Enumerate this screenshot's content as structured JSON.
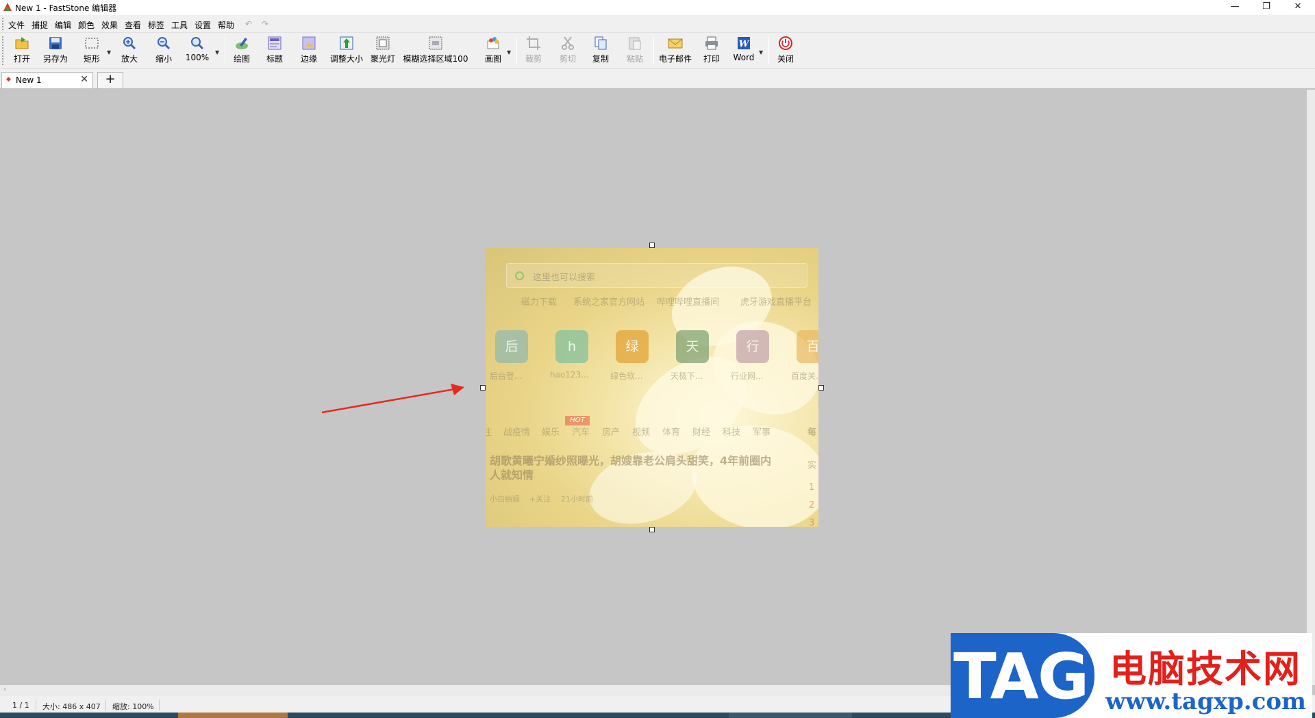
{
  "window": {
    "title": "New 1 - FastStone 编辑器",
    "controls": [
      "—",
      "❐",
      "✕"
    ]
  },
  "menu": {
    "items": [
      "文件",
      "捕捉",
      "编辑",
      "颜色",
      "效果",
      "查看",
      "标签",
      "工具",
      "设置",
      "帮助"
    ],
    "undo_icon": "↶",
    "redo_icon": "↷"
  },
  "toolbar": {
    "buttons": [
      {
        "label": "打开",
        "icon": "open-folder-icon",
        "enabled": true
      },
      {
        "label": "另存为",
        "icon": "save-disk-icon",
        "enabled": true
      },
      {
        "label": "矩形",
        "icon": "rect-select-icon",
        "enabled": true
      },
      {
        "label": "放大",
        "icon": "zoom-in-icon",
        "enabled": true
      },
      {
        "label": "缩小",
        "icon": "zoom-out-icon",
        "enabled": true
      },
      {
        "label": "100%",
        "icon": "zoom-icon",
        "enabled": true
      },
      {
        "label": "绘图",
        "icon": "draw-icon",
        "enabled": true
      },
      {
        "label": "标题",
        "icon": "caption-icon",
        "enabled": true
      },
      {
        "label": "边缘",
        "icon": "edge-icon",
        "enabled": true
      },
      {
        "label": "调整大小",
        "icon": "resize-icon",
        "enabled": true
      },
      {
        "label": "聚光灯",
        "icon": "spotlight-icon",
        "enabled": true
      },
      {
        "label": "模糊选择区域100",
        "icon": "blur-icon",
        "enabled": true
      },
      {
        "label": "画图",
        "icon": "paint-icon",
        "enabled": true
      },
      {
        "label": "裁剪",
        "icon": "crop-icon",
        "enabled": false
      },
      {
        "label": "剪切",
        "icon": "cut-icon",
        "enabled": false
      },
      {
        "label": "复制",
        "icon": "copy-icon",
        "enabled": true
      },
      {
        "label": "粘贴",
        "icon": "paste-icon",
        "enabled": false
      },
      {
        "label": "电子邮件",
        "icon": "email-icon",
        "enabled": true
      },
      {
        "label": "打印",
        "icon": "print-icon",
        "enabled": true
      },
      {
        "label": "Word",
        "icon": "word-icon",
        "enabled": true
      },
      {
        "label": "关闭",
        "icon": "power-icon",
        "enabled": true
      }
    ]
  },
  "tabs": {
    "active_label": "New 1",
    "close_glyph": "✕",
    "add_glyph": "+"
  },
  "image_content": {
    "search_placeholder": "这里也可以搜索",
    "quick_links": [
      "磁力下载",
      "系统之家官方网站",
      "哔哩哔哩直播间",
      "虎牙游戏直播平台"
    ],
    "tiles": [
      {
        "char": "后",
        "label": "后台登...",
        "color": "#8fb8b0"
      },
      {
        "char": "h",
        "label": "hao123...",
        "color": "#7cc0a0"
      },
      {
        "char": "绿",
        "label": "绿色软...",
        "color": "#e0a030"
      },
      {
        "char": "天",
        "label": "天极下...",
        "color": "#7a9e70"
      },
      {
        "char": "行",
        "label": "行业网...",
        "color": "#c0a0a8"
      },
      {
        "char": "百",
        "label": "百度关...",
        "color": "#e8b860"
      }
    ],
    "news_tabs": [
      "注",
      "战疫情",
      "娱乐",
      "汽车",
      "房产",
      "视频",
      "体育",
      "财经",
      "科技",
      "军事",
      "每"
    ],
    "hot_badge": "HOT",
    "headline": "胡歌黄曦宁婚纱照曝光，胡嫂靠老公肩头甜笑，4年前圈内人就知情",
    "meta": [
      "小白纳娱",
      "+关注",
      "21小时前"
    ],
    "side_text": "实",
    "side_numbers": [
      "1",
      "2",
      "3"
    ]
  },
  "status": {
    "page": "1 / 1",
    "size": "大小: 486 x 407",
    "zoom": "缩放: 100%"
  },
  "watermark": {
    "tag": "TAG",
    "cn_text": "电脑技术网",
    "url": "www.tagxp.com"
  },
  "colors": {
    "arrow": "#e8281e",
    "watermark_blue": "#1c64c8",
    "watermark_red": "#e4201a"
  }
}
